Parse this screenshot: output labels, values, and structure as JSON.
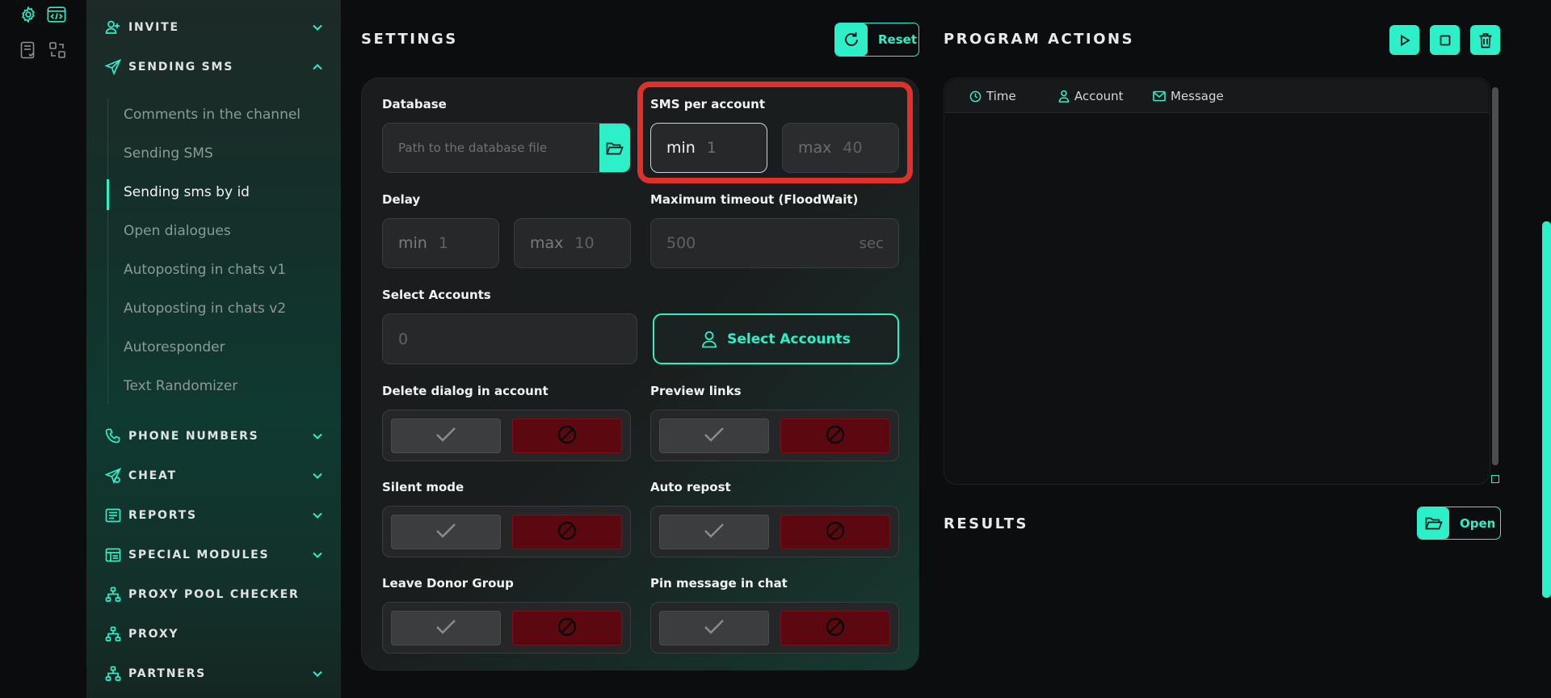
{
  "rail": {
    "icons": [
      "gear-icon",
      "code-window-icon",
      "checklist-icon",
      "swap-icon"
    ]
  },
  "sidebar": {
    "sections": [
      {
        "label": "INVITE",
        "icon": "user-add-icon",
        "expanded": false
      },
      {
        "label": "SENDING SMS",
        "icon": "paper-plane-icon",
        "expanded": true
      },
      {
        "label": "PHONE NUMBERS",
        "icon": "phone-icon",
        "expanded": false
      },
      {
        "label": "CHEAT",
        "icon": "paper-plane-plus-icon",
        "expanded": false
      },
      {
        "label": "REPORTS",
        "icon": "report-icon",
        "expanded": false
      },
      {
        "label": "SPECIAL MODULES",
        "icon": "modules-icon",
        "expanded": false
      },
      {
        "label": "PROXY POOL CHECKER",
        "icon": "network-icon",
        "expanded": null
      },
      {
        "label": "PROXY",
        "icon": "network-icon",
        "expanded": null
      },
      {
        "label": "PARTNERS",
        "icon": "network-icon",
        "expanded": false
      }
    ],
    "sub_items": [
      "Comments in the channel",
      "Sending SMS",
      "Sending sms by id",
      "Open dialogues",
      "Autoposting in chats v1",
      "Autoposting in chats v2",
      "Autoresponder",
      "Text Randomizer"
    ],
    "active_sub_index": 2
  },
  "settings": {
    "title": "SETTINGS",
    "reset_label": "Reset",
    "database": {
      "label": "Database",
      "placeholder": "Path to the database file"
    },
    "sms_per_account": {
      "label": "SMS per account",
      "min_prefix": "min",
      "min_value": "1",
      "max_prefix": "max",
      "max_value": "40"
    },
    "delay": {
      "label": "Delay",
      "min_prefix": "min",
      "min_value": "1",
      "max_prefix": "max",
      "max_value": "10"
    },
    "timeout": {
      "label": "Maximum timeout (FloodWait)",
      "value": "500",
      "unit": "sec"
    },
    "accounts": {
      "label": "Select Accounts",
      "value": "0",
      "button_label": "Select Accounts"
    },
    "toggles": [
      {
        "label": "Delete dialog in account"
      },
      {
        "label": "Preview links"
      },
      {
        "label": "Silent mode"
      },
      {
        "label": "Auto repost"
      },
      {
        "label": "Leave Donor Group"
      },
      {
        "label": "Pin message in chat"
      }
    ]
  },
  "program_actions": {
    "title": "PROGRAM ACTIONS",
    "columns": [
      "Time",
      "Account",
      "Message"
    ],
    "buttons": [
      "play-icon",
      "stop-icon",
      "trash-icon"
    ]
  },
  "results": {
    "title": "RESULTS",
    "open_label": "Open"
  },
  "colors": {
    "accent": "#2df0c8",
    "danger": "#5c0810",
    "highlight": "#e0302b"
  }
}
